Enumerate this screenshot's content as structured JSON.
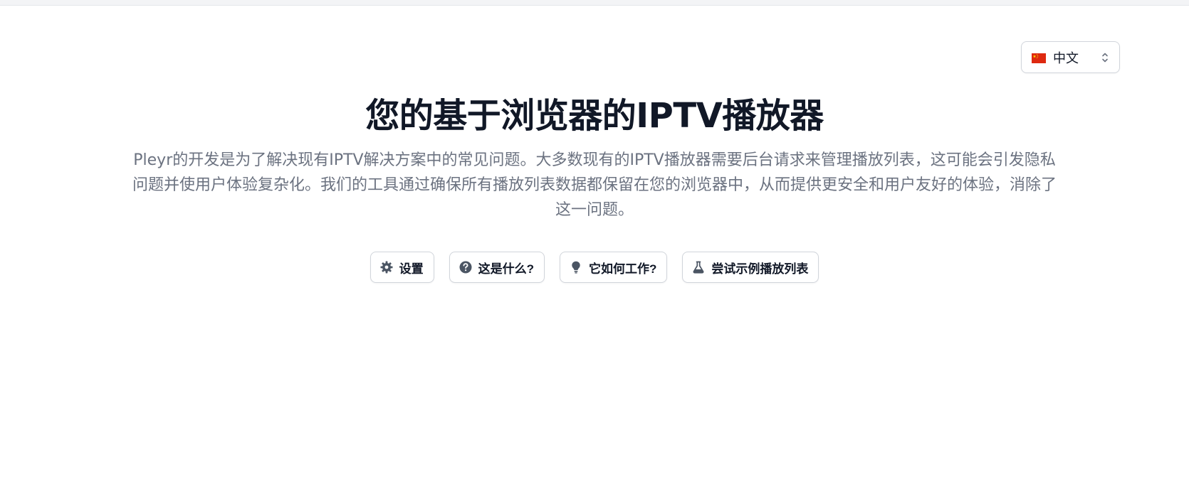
{
  "language_selector": {
    "selected_label": "中文",
    "flag_icon": "china-flag-icon",
    "flag_colors": {
      "field": "#de2910",
      "stars": "#ffde00"
    }
  },
  "hero": {
    "title": "您的基于浏览器的IPTV播放器",
    "description": "Pleyr的开发是为了解决现有IPTV解决方案中的常见问题。大多数现有的IPTV播放器需要后台请求来管理播放列表，这可能会引发隐私问题并使用户体验复杂化。我们的工具通过确保所有播放列表数据都保留在您的浏览器中，从而提供更安全和用户友好的体验，消除了这一问题。"
  },
  "actions": {
    "settings": {
      "label": "设置",
      "icon": "gear-icon"
    },
    "what_is_this": {
      "label": "这是什么?",
      "icon": "question-circle-icon"
    },
    "how_it_works": {
      "label": "它如何工作?",
      "icon": "lightbulb-icon"
    },
    "try_sample": {
      "label": "尝试示例播放列表",
      "icon": "flask-icon"
    }
  },
  "colors": {
    "text_primary": "#111827",
    "text_muted": "#6b7280",
    "border": "#d1d5db",
    "icon": "#4b5563"
  }
}
